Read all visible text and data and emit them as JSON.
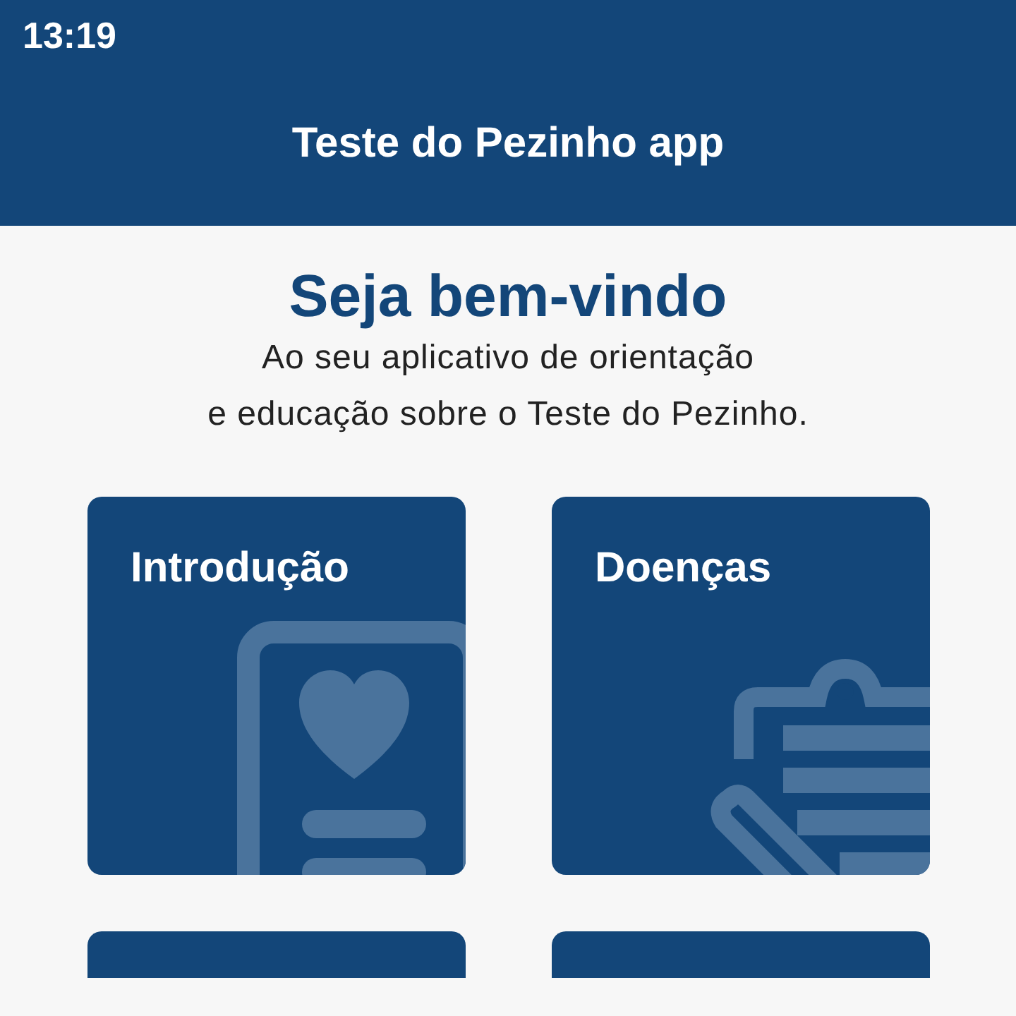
{
  "status_bar": {
    "time": "13:19"
  },
  "app_bar": {
    "title": "Teste do Pezinho app"
  },
  "welcome": {
    "heading": "Seja bem-vindo",
    "lines": [
      "Ao seu aplicativo de orientação",
      "e educação sobre o Teste do Pezinho."
    ]
  },
  "cards": [
    {
      "kind": "document",
      "title": "Introdução"
    },
    {
      "kind": "clipboard",
      "title": "Doenças"
    },
    {
      "kind": "blank"
    },
    {
      "kind": "blank"
    }
  ]
}
